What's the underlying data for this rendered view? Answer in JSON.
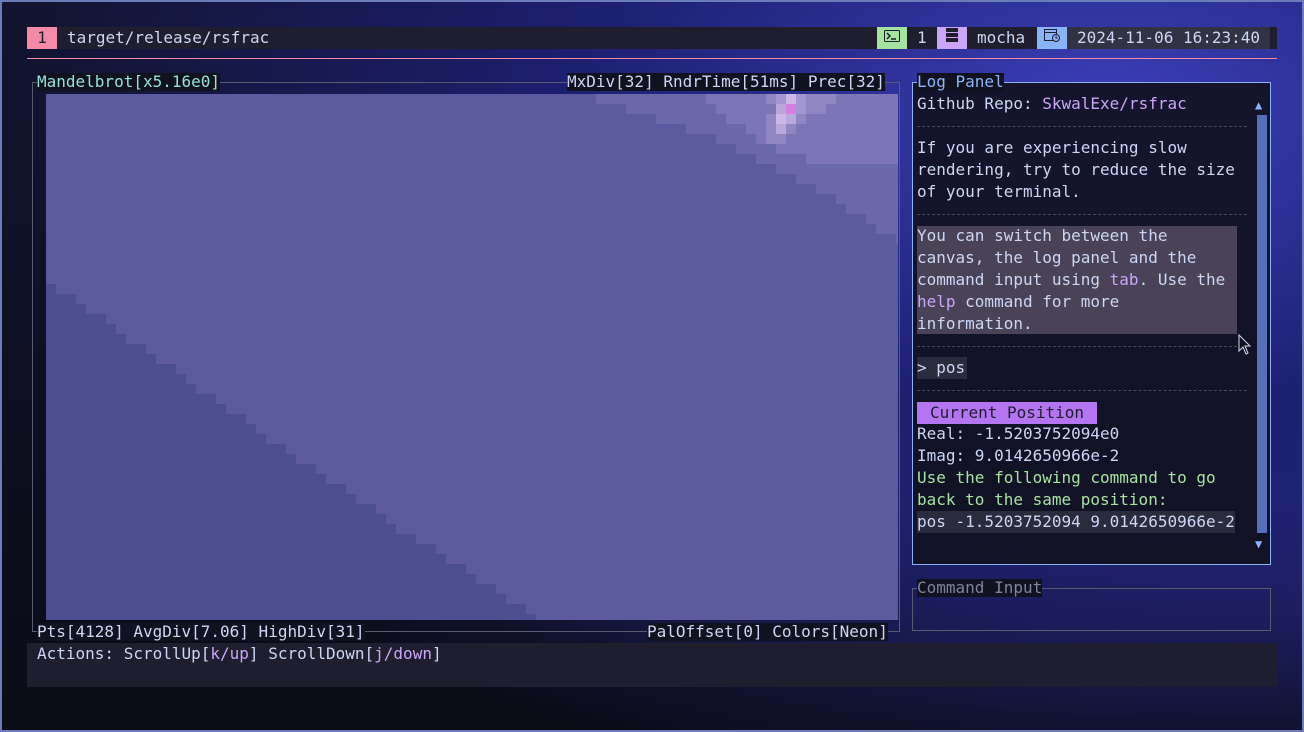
{
  "topbar": {
    "workspace": "1",
    "title": "target/release/rsfrac",
    "terminal_icon": "terminal-icon",
    "terminal_count": "1",
    "host_icon": "server-icon",
    "host": "mocha",
    "clock_icon": "calendar-clock-icon",
    "datetime": "2024-11-06 16:23:40"
  },
  "canvas": {
    "title": "Mandelbrot[x5.16e0]",
    "stats_right": "MxDiv[32] RndrTime[51ms] Prec[32]",
    "footer_left": "Pts[4128] AvgDiv[7.06] HighDiv[31]",
    "footer_right": "PalOffset[0] Colors[Neon]"
  },
  "log": {
    "title": "Log Panel",
    "repo_label": "Github Repo: ",
    "repo_link": "SkwalExe/rsfrac",
    "slow_lines": [
      "If you are experiencing slow",
      "rendering, try to reduce the size",
      "of your terminal."
    ],
    "tip_line1": "You can switch between the",
    "tip_line2": "canvas, the log panel and the",
    "tip_line3a": "command input using ",
    "tip_tab": "tab",
    "tip_line3b": ". Use the",
    "tip_help": "help",
    "tip_line4b": " command for more",
    "tip_line5": "information.",
    "command_echo": "> pos",
    "badge": "Current Position",
    "real": "Real: -1.5203752094e0",
    "imag": "Imag: 9.0142650966e-2",
    "hint_line1": "Use the following command to go",
    "hint_line2": "back to the same position:",
    "pos_command": "pos -1.5203752094 9.0142650966e-2"
  },
  "command_input": {
    "title": "Command Input",
    "value": ""
  },
  "actions": {
    "prefix": "Actions: ScrollUp[",
    "up_keys": "k/up",
    "middle": "] ScrollDown[",
    "down_keys": "j/down",
    "suffix": "]"
  },
  "colors": {
    "accent": "#cba6f7",
    "highlight_green": "#a6e3a1",
    "workspace": "#f38ba8",
    "terminal_seg": "#a6e3a1",
    "host_seg": "#cba6f7",
    "clock_seg": "#89b4fa"
  }
}
